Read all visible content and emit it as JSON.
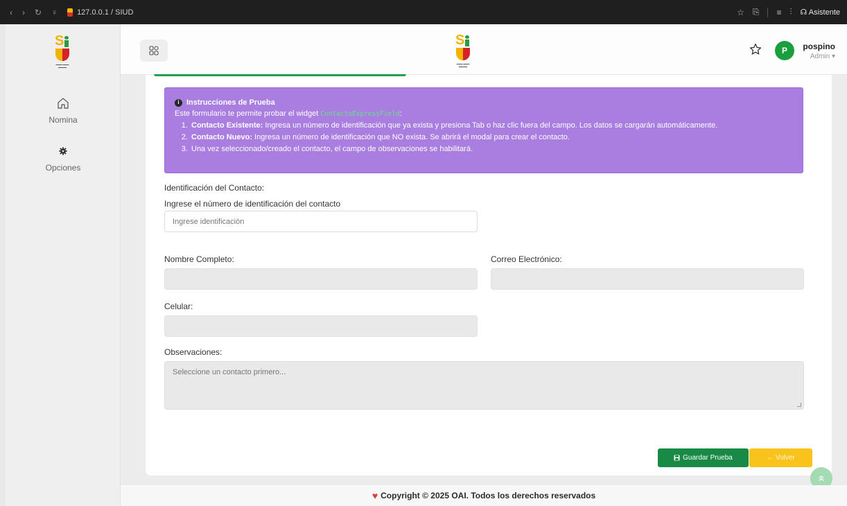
{
  "browser": {
    "url": "127.0.0.1 / SIUD",
    "assistant_label": "Asistente"
  },
  "sidebar": {
    "items": [
      {
        "label": "Nomina",
        "icon": "home-icon"
      },
      {
        "label": "Opciones",
        "icon": "gear-icon"
      }
    ]
  },
  "header": {
    "user_name": "pospino",
    "user_role": "Admin ▾",
    "avatar_initial": "P"
  },
  "info": {
    "title": "Instrucciones de Prueba",
    "intro": "Este formulario te permite probar el widget",
    "widget_name": "ContactoExpressField",
    "intro_end": ":",
    "steps": [
      {
        "bold": "Contacto Existente:",
        "text": " Ingresa un número de identificación que ya exista y presiona Tab o haz clic fuera del campo. Los datos se cargarán automáticamente."
      },
      {
        "bold": "Contacto Nuevo:",
        "text": " Ingresa un número de identificación que NO exista. Se abrirá el modal para crear el contacto."
      },
      {
        "bold": "",
        "text": "Una vez seleccionado/creado el contacto, el campo de observaciones se habilitará."
      }
    ]
  },
  "form": {
    "section_label": "Identificación del Contacto:",
    "id_help": "Ingrese el número de identificación del contacto",
    "id_placeholder": "Ingrese identificación",
    "full_name_label": "Nombre Completo:",
    "email_label": "Correo Electrónico:",
    "phone_label": "Celular:",
    "observations_label": "Observaciones:",
    "observations_placeholder": "Seleccione un contacto primero..."
  },
  "buttons": {
    "save": "Guardar Prueba",
    "back": "← Volver"
  },
  "footer": {
    "text": "Copyright © 2025 OAI. Todos los derechos reservados"
  },
  "colors": {
    "info_bg": "#a97ee0",
    "primary_green": "#198a45",
    "warning_yellow": "#f8c41c"
  }
}
